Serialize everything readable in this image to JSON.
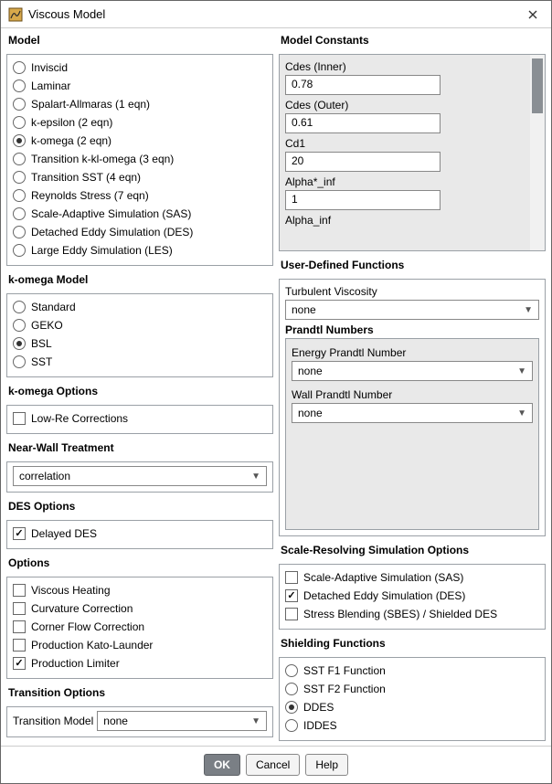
{
  "window": {
    "title": "Viscous Model"
  },
  "left": {
    "model": {
      "title": "Model",
      "options": [
        "Inviscid",
        "Laminar",
        "Spalart-Allmaras (1 eqn)",
        "k-epsilon (2 eqn)",
        "k-omega (2 eqn)",
        "Transition k-kl-omega (3 eqn)",
        "Transition SST (4 eqn)",
        "Reynolds Stress (7 eqn)",
        "Scale-Adaptive Simulation (SAS)",
        "Detached Eddy Simulation (DES)",
        "Large Eddy Simulation (LES)"
      ],
      "selected_index": 4
    },
    "komega_model": {
      "title": "k-omega Model",
      "options": [
        "Standard",
        "GEKO",
        "BSL",
        "SST"
      ],
      "selected_index": 2
    },
    "komega_options": {
      "title": "k-omega Options",
      "low_re_corrections": {
        "label": "Low-Re Corrections",
        "checked": false
      }
    },
    "near_wall": {
      "title": "Near-Wall Treatment",
      "value": "correlation"
    },
    "des_options": {
      "title": "DES Options",
      "delayed_des": {
        "label": "Delayed DES",
        "checked": true
      }
    },
    "options": {
      "title": "Options",
      "items": [
        {
          "label": "Viscous Heating",
          "checked": false
        },
        {
          "label": "Curvature Correction",
          "checked": false
        },
        {
          "label": "Corner Flow Correction",
          "checked": false
        },
        {
          "label": "Production Kato-Launder",
          "checked": false
        },
        {
          "label": "Production Limiter",
          "checked": true
        }
      ]
    },
    "transition_options": {
      "title": "Transition Options",
      "label": "Transition Model",
      "value": "none"
    }
  },
  "right": {
    "model_constants": {
      "title": "Model Constants",
      "fields": [
        {
          "label": "Cdes (Inner)",
          "value": "0.78"
        },
        {
          "label": "Cdes (Outer)",
          "value": "0.61"
        },
        {
          "label": "Cd1",
          "value": "20"
        },
        {
          "label": "Alpha*_inf",
          "value": "1"
        },
        {
          "label": "Alpha_inf",
          "value": ""
        }
      ]
    },
    "udf": {
      "title": "User-Defined Functions",
      "turb_visc": {
        "label": "Turbulent Viscosity",
        "value": "none"
      },
      "prandtl_title": "Prandtl Numbers",
      "energy_prandtl": {
        "label": "Energy Prandtl Number",
        "value": "none"
      },
      "wall_prandtl": {
        "label": "Wall Prandtl Number",
        "value": "none"
      }
    },
    "srs": {
      "title": "Scale-Resolving Simulation Options",
      "items": [
        {
          "label": "Scale-Adaptive Simulation (SAS)",
          "checked": false
        },
        {
          "label": "Detached Eddy Simulation (DES)",
          "checked": true
        },
        {
          "label": "Stress Blending (SBES) / Shielded DES",
          "checked": false
        }
      ]
    },
    "shielding": {
      "title": "Shielding Functions",
      "options": [
        "SST F1 Function",
        "SST F2 Function",
        "DDES",
        "IDDES"
      ],
      "selected_index": 2
    }
  },
  "footer": {
    "ok": "OK",
    "cancel": "Cancel",
    "help": "Help"
  }
}
